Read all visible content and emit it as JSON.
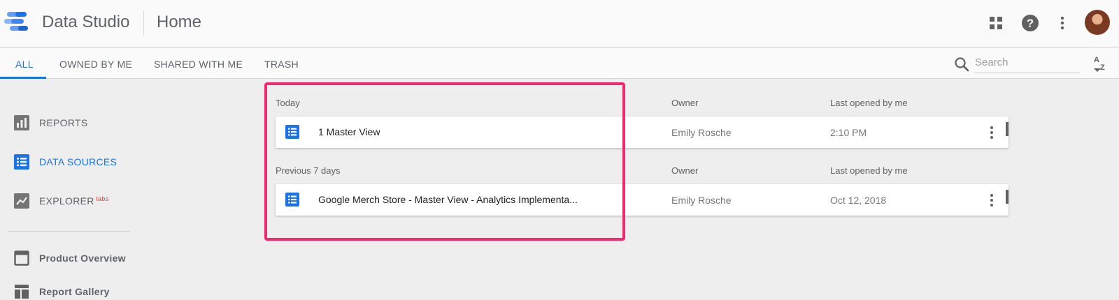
{
  "app": {
    "title": "Data Studio",
    "page_title": "Home"
  },
  "header": {
    "icons": [
      "apps-grid-icon",
      "help-icon",
      "more-vert-icon",
      "avatar"
    ],
    "colors": {
      "accent": "#1a73e8",
      "highlight": "#f3286f",
      "doc_icon": "#1a73e8"
    }
  },
  "tabs": [
    {
      "label": "ALL",
      "active": true
    },
    {
      "label": "OWNED BY ME",
      "active": false
    },
    {
      "label": "SHARED WITH ME",
      "active": false
    },
    {
      "label": "TRASH",
      "active": false
    }
  ],
  "search": {
    "placeholder": "Search",
    "value": ""
  },
  "sort": {
    "icon": "sort-az-icon"
  },
  "sidebar": {
    "items": [
      {
        "label": "REPORTS",
        "icon": "bar-chart-icon",
        "active": false
      },
      {
        "label": "DATA SOURCES",
        "icon": "list-doc-icon",
        "active": true
      },
      {
        "label": "EXPLORER",
        "badge": "labs",
        "icon": "trending-icon",
        "active": false
      },
      {
        "label": "Product Overview",
        "icon": "window-icon",
        "active": false
      },
      {
        "label": "Report Gallery",
        "icon": "gallery-icon",
        "active": false
      }
    ]
  },
  "main": {
    "sections": [
      {
        "label": "Today",
        "owner_header": "Owner",
        "opened_header": "Last opened by me",
        "rows": [
          {
            "name": "1 Master View",
            "owner": "Emily Rosche",
            "opened": "2:10 PM"
          }
        ]
      },
      {
        "label": "Previous 7 days",
        "owner_header": "Owner",
        "opened_header": "Last opened by me",
        "rows": [
          {
            "name": "Google Merch Store - Master View - Analytics Implementa...",
            "owner": "Emily Rosche",
            "opened": "Oct 12, 2018"
          }
        ]
      }
    ]
  }
}
